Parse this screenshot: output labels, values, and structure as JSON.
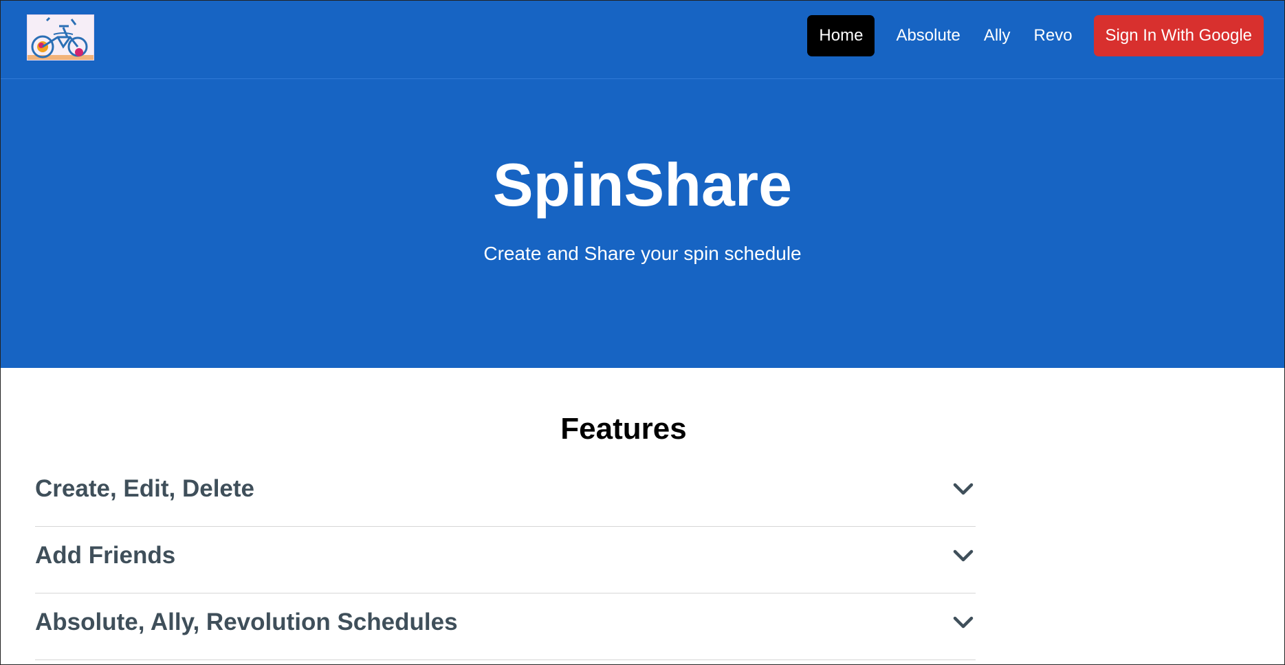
{
  "colors": {
    "brand_blue": "#1764c3",
    "active_nav": "#000000",
    "signin_red": "#d8302e",
    "accordion_text": "#3f4f5a"
  },
  "navbar": {
    "logo_icon": "bicycle-logo-icon",
    "links": [
      {
        "label": "Home",
        "active": true
      },
      {
        "label": "Absolute",
        "active": false
      },
      {
        "label": "Ally",
        "active": false
      },
      {
        "label": "Revo",
        "active": false
      }
    ],
    "signin_label": "Sign In With Google"
  },
  "hero": {
    "title": "SpinShare",
    "subtitle": "Create and Share your spin schedule"
  },
  "features": {
    "title": "Features",
    "items": [
      {
        "label": "Create, Edit, Delete",
        "icon": "chevron-down-icon"
      },
      {
        "label": "Add Friends",
        "icon": "chevron-down-icon"
      },
      {
        "label": "Absolute, Ally, Revolution Schedules",
        "icon": "chevron-down-icon"
      }
    ]
  }
}
